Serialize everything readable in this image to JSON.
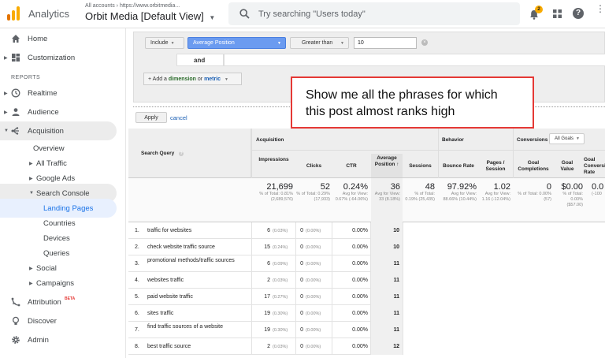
{
  "topbar": {
    "app_name": "Analytics",
    "account_path": "All accounts › https://www.orbitmedia...",
    "view_name": "Orbit Media [Default View]",
    "search_placeholder": "Try searching \"Users today\"",
    "notif_count": "2"
  },
  "sidebar": {
    "home": "Home",
    "customization": "Customization",
    "reports_header": "REPORTS",
    "realtime": "Realtime",
    "audience": "Audience",
    "acquisition": "Acquisition",
    "overview": "Overview",
    "all_traffic": "All Traffic",
    "google_ads": "Google Ads",
    "search_console": "Search Console",
    "landing_pages": "Landing Pages",
    "countries": "Countries",
    "devices": "Devices",
    "queries": "Queries",
    "social": "Social",
    "campaigns": "Campaigns",
    "attribution": "Attribution",
    "beta": "BETA",
    "discover": "Discover",
    "admin": "Admin"
  },
  "filter": {
    "include": "Include",
    "dimension": "Average Position",
    "operator": "Greater than",
    "value": "10",
    "and_label": "and",
    "add_prefix": "+ Add a",
    "add_dimension": "dimension",
    "add_or": "or",
    "add_metric": "metric",
    "apply": "Apply",
    "cancel": "cancel"
  },
  "callout": {
    "text": "Show me all the phrases for which this post almost ranks high"
  },
  "table": {
    "group_acquisition": "Acquisition",
    "group_behavior": "Behavior",
    "group_conversions": "Conversions",
    "goals_select": "All Goals",
    "col_query": "Search Query",
    "col_impressions": "Impressions",
    "col_clicks": "Clicks",
    "col_ctr": "CTR",
    "col_avg_position": "Average Position",
    "col_sessions": "Sessions",
    "col_bounce": "Bounce Rate",
    "col_pages": "Pages / Session",
    "col_goal_completions": "Goal Completions",
    "col_goal_value": "Goal Value",
    "col_goal_conv": "Goal Conversion Rate",
    "totals": {
      "impressions": "21,699",
      "impressions_sub": "% of Total: 0.81% (2,689,576)",
      "clicks": "52",
      "clicks_sub": "% of Total: 0.29% (17,933)",
      "ctr": "0.24%",
      "ctr_sub": "Avg for View: 0.67% (-64.06%)",
      "position": "36",
      "position_sub": "Avg for View: 33 (8.18%)",
      "sessions": "48",
      "sessions_sub": "% of Total: 0.19% (25,435)",
      "bounce": "97.92%",
      "bounce_sub": "Avg for View: 88.66% (10.44%)",
      "pages": "1.02",
      "pages_sub": "Avg for View: 1.16 (-12.04%)",
      "goal_completions": "0",
      "goal_completions_sub": "% of Total: 0.00% (57)",
      "goal_value": "$0.00",
      "goal_value_sub": "% of Total: 0.00% ($57.00)",
      "goal_conv": "0.0",
      "goal_conv_sub": "(-100"
    },
    "rows": [
      {
        "n": "1.",
        "query": "traffic for websites",
        "imp": "6",
        "imp_pct": "(0.03%)",
        "clicks": "0",
        "clicks_pct": "(0.00%)",
        "ctr": "0.00%",
        "pos": "10"
      },
      {
        "n": "2.",
        "query": "check website traffic source",
        "imp": "15",
        "imp_pct": "(0.24%)",
        "clicks": "0",
        "clicks_pct": "(0.00%)",
        "ctr": "0.00%",
        "pos": "10"
      },
      {
        "n": "3.",
        "query": "promotional methods/traffic sources",
        "imp": "6",
        "imp_pct": "(0.09%)",
        "clicks": "0",
        "clicks_pct": "(0.00%)",
        "ctr": "0.00%",
        "pos": "11"
      },
      {
        "n": "4.",
        "query": "websites traffic",
        "imp": "2",
        "imp_pct": "(0.03%)",
        "clicks": "0",
        "clicks_pct": "(0.00%)",
        "ctr": "0.00%",
        "pos": "11"
      },
      {
        "n": "5.",
        "query": "paid website traffic",
        "imp": "17",
        "imp_pct": "(0.27%)",
        "clicks": "0",
        "clicks_pct": "(0.00%)",
        "ctr": "0.00%",
        "pos": "11"
      },
      {
        "n": "6.",
        "query": "sites traffic",
        "imp": "19",
        "imp_pct": "(0.30%)",
        "clicks": "0",
        "clicks_pct": "(0.00%)",
        "ctr": "0.00%",
        "pos": "11"
      },
      {
        "n": "7.",
        "query": "find traffic sources of a website",
        "imp": "19",
        "imp_pct": "(0.30%)",
        "clicks": "0",
        "clicks_pct": "(0.00%)",
        "ctr": "0.00%",
        "pos": "11"
      },
      {
        "n": "8.",
        "query": "best traffic source",
        "imp": "2",
        "imp_pct": "(0.03%)",
        "clicks": "0",
        "clicks_pct": "(0.00%)",
        "ctr": "0.00%",
        "pos": "12"
      }
    ]
  },
  "colors": {
    "accent_blue": "#4285f4",
    "logo_orange": "#f9ab00",
    "callout_border": "#e53935",
    "selected_nav_bg": "#e8f0fe"
  }
}
